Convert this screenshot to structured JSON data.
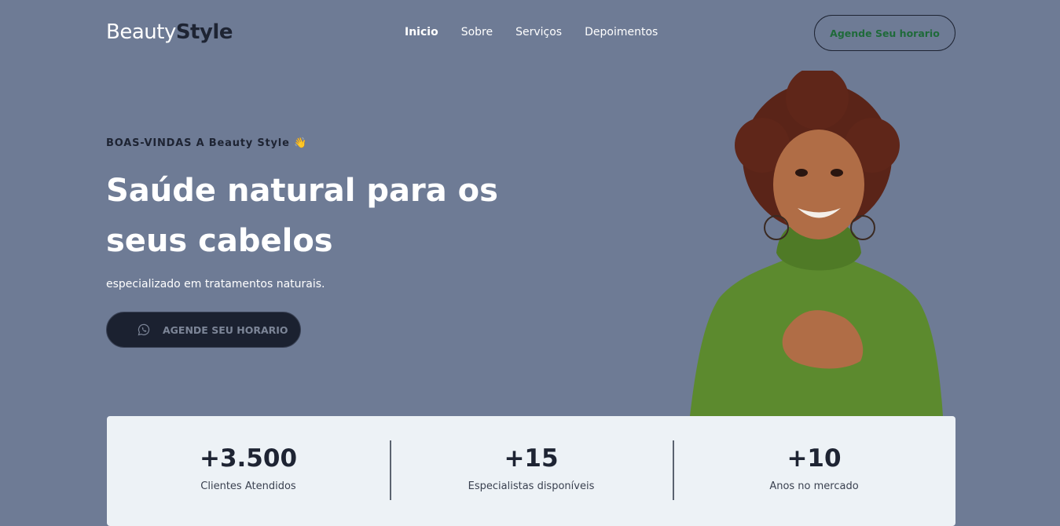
{
  "header": {
    "logo_light": "Beauty",
    "logo_bold": "Style",
    "nav": [
      "Inicio",
      "Sobre",
      "Serviços",
      "Depoimentos"
    ],
    "cta_label": "Agende Seu horario"
  },
  "hero": {
    "eyebrow": "BOAS-VINDAS A Beauty Style 👋",
    "title": "Saúde natural para os seus cabelos",
    "subtitle": "especializado em tratamentos naturais.",
    "button_label": "AGENDE SEU HORARIO",
    "button_icon": "whatsapp-icon"
  },
  "stats": [
    {
      "value": "+3.500",
      "label": "Clientes Atendidos"
    },
    {
      "value": "+15",
      "label": "Especialistas disponíveis"
    },
    {
      "value": "+10",
      "label": "Anos no mercado"
    }
  ],
  "colors": {
    "background": "#6e7b95",
    "dark": "#1e2433",
    "accent_green": "#1f6a3a",
    "stats_bg": "#edf2f6"
  }
}
